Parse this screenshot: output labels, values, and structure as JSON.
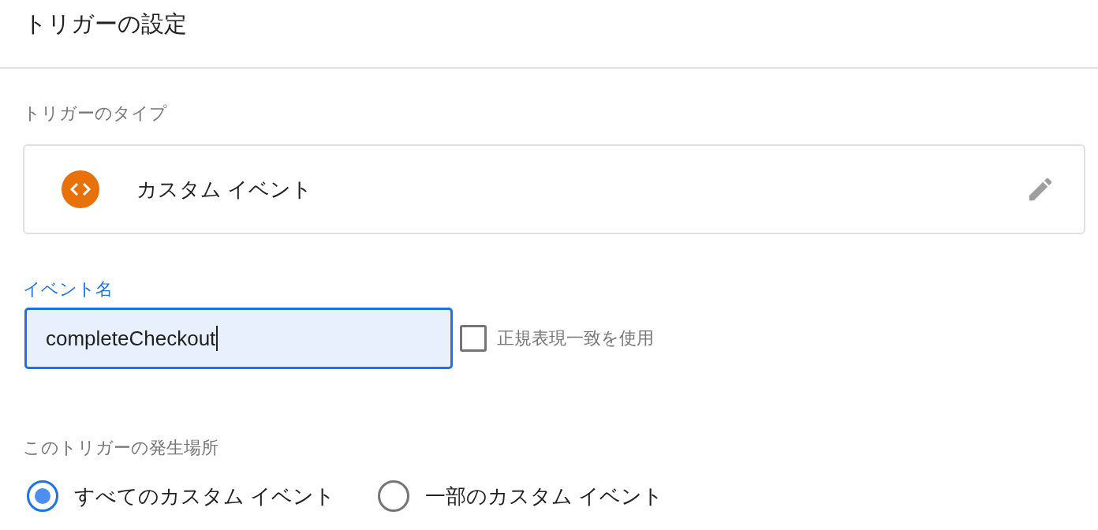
{
  "title": "トリガーの設定",
  "trigger_type": {
    "label": "トリガーのタイプ",
    "name": "カスタム イベント"
  },
  "event_name": {
    "label": "イベント名",
    "value": "completeCheckout",
    "focused": true
  },
  "regex_match": {
    "label": "正規表現一致を使用",
    "checked": false
  },
  "fires_on": {
    "label": "このトリガーの発生場所",
    "options": [
      {
        "label": "すべてのカスタム イベント",
        "selected": true
      },
      {
        "label": "一部のカスタム イベント",
        "selected": false
      }
    ]
  }
}
